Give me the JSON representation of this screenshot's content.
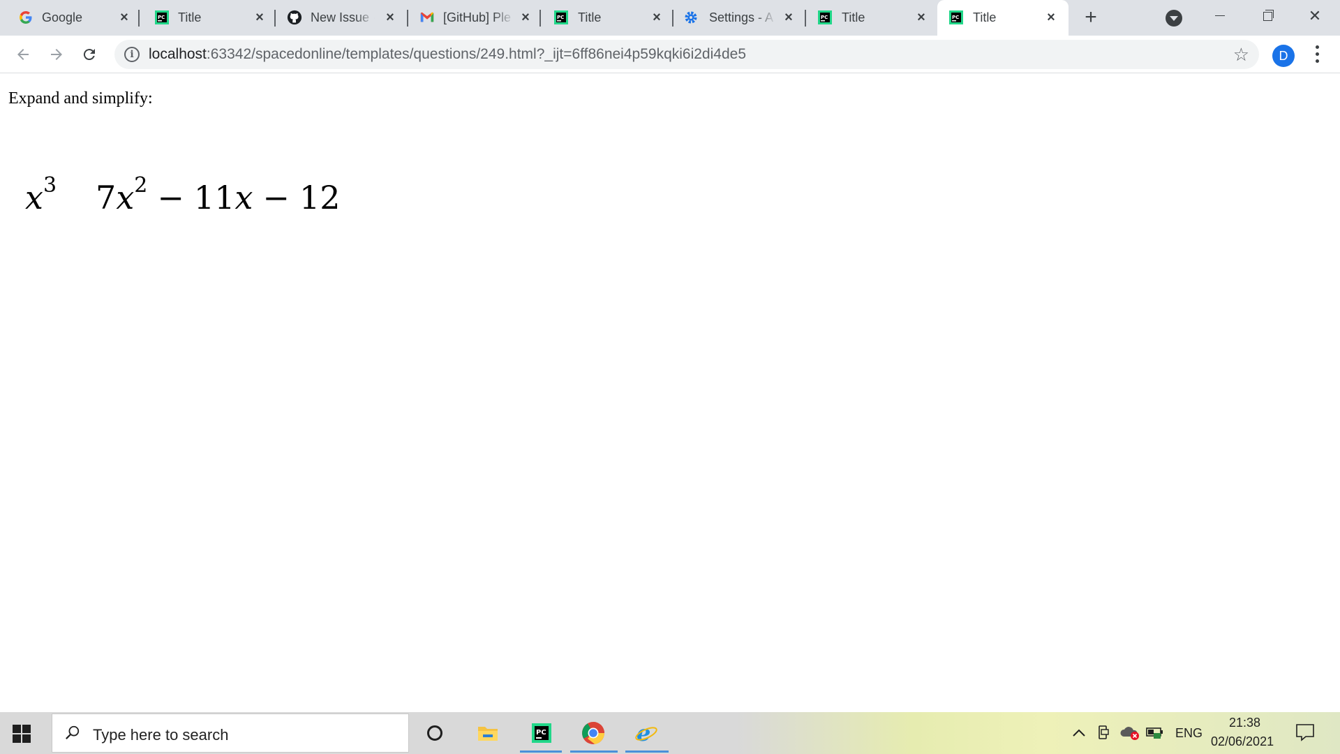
{
  "browser": {
    "tabs": [
      {
        "label": "Google",
        "icon": "google-icon",
        "active": false
      },
      {
        "label": "Title",
        "icon": "pycharm-icon",
        "active": false
      },
      {
        "label": "New Issue ·",
        "icon": "github-icon",
        "active": false
      },
      {
        "label": "[GitHub] Ple",
        "icon": "gmail-icon",
        "active": false
      },
      {
        "label": "Title",
        "icon": "pycharm-icon",
        "active": false
      },
      {
        "label": "Settings - A",
        "icon": "gear-icon",
        "active": false
      },
      {
        "label": "Title",
        "icon": "pycharm-icon",
        "active": false
      },
      {
        "label": "Title",
        "icon": "pycharm-icon",
        "active": true
      }
    ],
    "address": {
      "host": "localhost",
      "path": ":63342/spacedonline/templates/questions/249.html?_ijt=6ff86nei4p59kqki6i2di4de5"
    },
    "profile_initial": "D"
  },
  "page": {
    "prompt": "Expand and simplify:",
    "expression": {
      "left_var": "x",
      "left_exp": "3",
      "coef1": "7",
      "var1": "x",
      "exp1": "2",
      "op1": "−",
      "coef2": "11",
      "var2": "x",
      "op2": "−",
      "const": "12"
    }
  },
  "taskbar": {
    "search_placeholder": "Type here to search",
    "language": "ENG",
    "time": "21:38",
    "date": "02/06/2021"
  }
}
